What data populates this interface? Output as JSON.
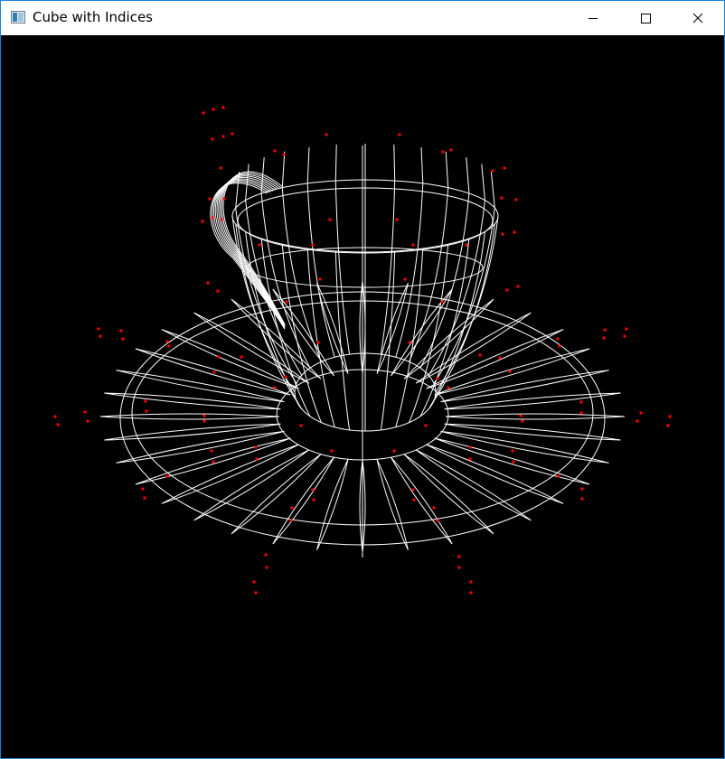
{
  "window": {
    "title": "Cube with Indices",
    "icon": "app-icon",
    "accent_border": "#1883d7"
  },
  "titlebar": {
    "buttons": [
      {
        "name": "minimize",
        "icon": "minimize-icon"
      },
      {
        "name": "maximize",
        "icon": "maximize-icon"
      },
      {
        "name": "close",
        "icon": "close-icon"
      }
    ]
  },
  "viewport": {
    "background": "#000000",
    "wireframe_color": "#ffffff",
    "point_color": "#ff0000",
    "scene": "wireframe teacup and saucer with vertex points"
  }
}
